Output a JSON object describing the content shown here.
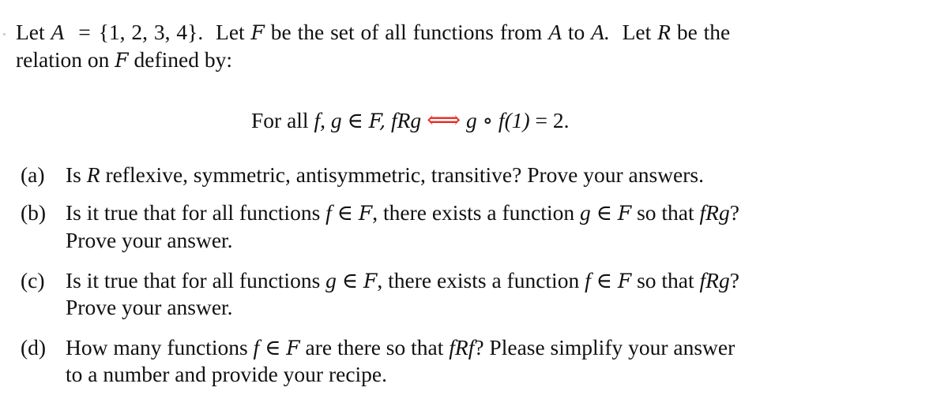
{
  "intro": {
    "line1": {
      "let": "Let",
      "A": "A",
      "eq": "=",
      "set": "{1, 2, 3, 4}.",
      "let2": "Let",
      "F": "F",
      "mid": "be the set of all functions from",
      "A2": "A",
      "to": "to",
      "A3": "A.",
      "let3": "Let",
      "R": "R",
      "end": "be the"
    },
    "line2": {
      "start": "relation on",
      "F": "F",
      "end": "defined by:"
    }
  },
  "definition": {
    "for_all": "For all",
    "vars": "f, g",
    "in": "∈",
    "F": "F,",
    "rel": "fRg",
    "iff": "⟺",
    "comp": "g ∘ f(1)",
    "eq": "=",
    "val": "2.",
    "iff_color": "#e8281e"
  },
  "parts": [
    {
      "label": "(a)",
      "lines": [
        {
          "pre": "Is",
          "m1": "R",
          "post": "reflexive, symmetric, antisymmetric, transitive? Prove your answers."
        }
      ]
    },
    {
      "label": "(b)",
      "lines": [
        {
          "pre": "Is it true that for all functions",
          "m1": "f",
          "in": "∈",
          "F": "F",
          "mid": ", there exists a function",
          "m2": "g",
          "in2": "∈",
          "F2": "F",
          "so": "so that",
          "m3": "fRg",
          "q": "?"
        },
        {
          "text": "Prove your answer."
        }
      ]
    },
    {
      "label": "(c)",
      "lines": [
        {
          "pre": "Is it true that for all functions",
          "m1": "g",
          "in": "∈",
          "F": "F",
          "mid": ", there exists a function",
          "m2": "f",
          "in2": "∈",
          "F2": "F",
          "so": "so that",
          "m3": "fRg",
          "q": "?"
        },
        {
          "text": "Prove your answer."
        }
      ]
    },
    {
      "label": "(d)",
      "lines": [
        {
          "pre": "How many functions",
          "m1": "f",
          "in": "∈",
          "F": "F",
          "mid": "are there so that",
          "m3": "fRf",
          "post": "? Please simplify your answer"
        },
        {
          "text": "to a number and provide your recipe."
        }
      ]
    }
  ]
}
